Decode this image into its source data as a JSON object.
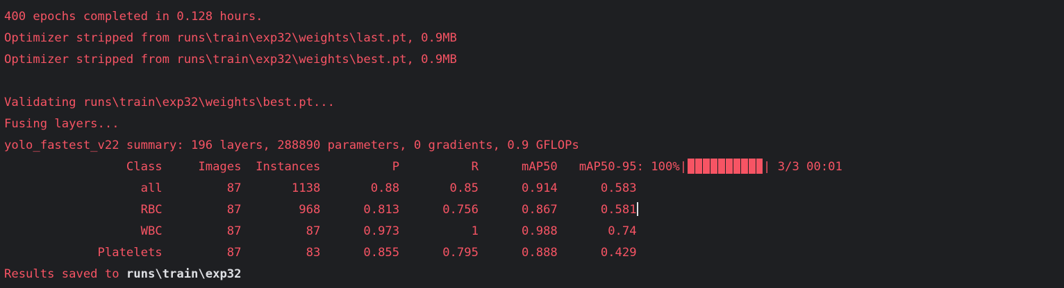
{
  "colors": {
    "background": "#1e1f22",
    "stderr_text": "#f75464",
    "highlight_text": "#dfe1e5"
  },
  "console": {
    "lines": [
      "400 epochs completed in 0.128 hours.",
      "Optimizer stripped from runs\\train\\exp32\\weights\\last.pt, 0.9MB",
      "Optimizer stripped from runs\\train\\exp32\\weights\\best.pt, 0.9MB",
      "",
      "Validating runs\\train\\exp32\\weights\\best.pt...",
      "Fusing layers...",
      "yolo_fastest_v22 summary: 196 layers, 288890 parameters, 0 gradients, 0.9 GFLOPs"
    ],
    "header": {
      "text": "                 Class     Images  Instances          P          R      mAP50   mAP50-95: 100%|",
      "progress_suffix": "| 3/3 00:01",
      "progress_fraction": 1.0
    },
    "rows": [
      "                   all         87       1138       0.88       0.85      0.914      0.583",
      "                   RBC         87        968      0.813      0.756      0.867      0.581",
      "                   WBC         87         87      0.973          1      0.988       0.74",
      "             Platelets         87         83      0.855      0.795      0.888      0.429"
    ],
    "results": {
      "prefix": "Results saved to ",
      "path": "runs\\train\\exp32"
    }
  }
}
